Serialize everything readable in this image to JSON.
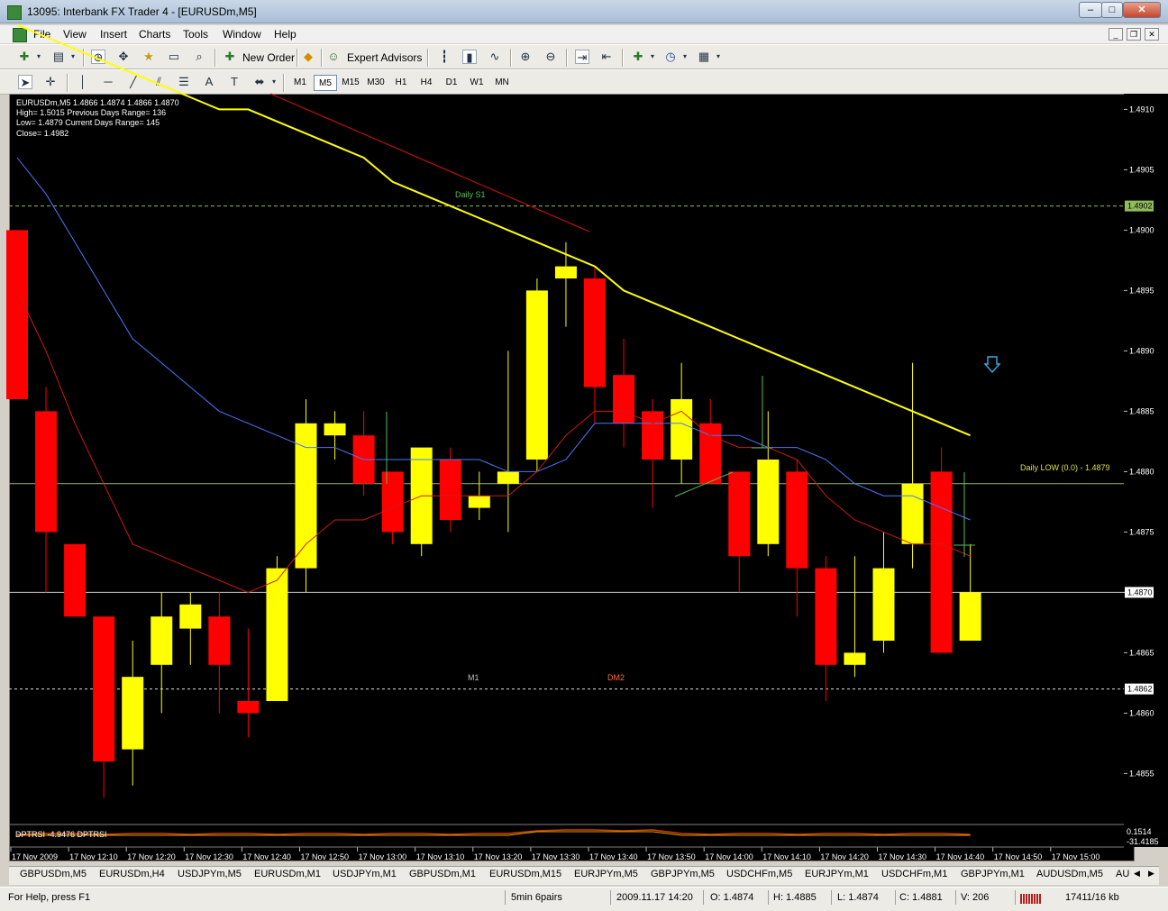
{
  "window": {
    "title": "13095: Interbank FX Trader 4 - [EURUSDm,M5]",
    "min": "–",
    "max": "□",
    "close": "✕"
  },
  "menu": [
    "File",
    "View",
    "Insert",
    "Charts",
    "Tools",
    "Window",
    "Help"
  ],
  "toolbar": {
    "new_order": "New Order",
    "expert_advisors": "Expert Advisors"
  },
  "timeframes": [
    "M1",
    "M5",
    "M15",
    "M30",
    "H1",
    "H4",
    "D1",
    "W1",
    "MN"
  ],
  "active_timeframe": "M5",
  "chart_info": {
    "line1": "EURUSDm,M5  1.4866 1.4874 1.4866 1.4870",
    "line2": "High= 1.5015    Previous Days Range= 136",
    "line3": "Low= 1.4879     Current Days Range= 145",
    "line4": "Close= 1.4982"
  },
  "labels": {
    "daily_s1": "Daily S1",
    "daily_low": "Daily LOW (0.0) - 1.4879",
    "m1": "M1",
    "dm2": "DM2"
  },
  "indicator": {
    "label": "DPTRSI -4.9476  DPTRSI",
    "scale_top": "0.1514",
    "scale_bottom": "-31.4185"
  },
  "price_axis": {
    "ticks": [
      "1.4910",
      "1.4905",
      "1.4900",
      "1.4895",
      "1.4890",
      "1.4885",
      "1.4880",
      "1.4875",
      "1.4870",
      "1.4865",
      "1.4860",
      "1.4855"
    ],
    "marker_upper": "1.4902",
    "marker_current": "1.4870",
    "marker_lower": "1.4862"
  },
  "time_axis": [
    "17 Nov 2009",
    "17 Nov 12:10",
    "17 Nov 12:20",
    "17 Nov 12:30",
    "17 Nov 12:40",
    "17 Nov 12:50",
    "17 Nov 13:00",
    "17 Nov 13:10",
    "17 Nov 13:20",
    "17 Nov 13:30",
    "17 Nov 13:40",
    "17 Nov 13:50",
    "17 Nov 14:00",
    "17 Nov 14:10",
    "17 Nov 14:20",
    "17 Nov 14:30",
    "17 Nov 14:40",
    "17 Nov 14:50",
    "17 Nov 15:00"
  ],
  "tabs": [
    "GBPUSDm,M5",
    "EURUSDm,H4",
    "USDJPYm,M5",
    "EURUSDm,M1",
    "USDJPYm,M1",
    "GBPUSDm,M1",
    "EURUSDm,M15",
    "EURJPYm,M5",
    "GBPJPYm,M5",
    "USDCHFm,M5",
    "EURJPYm,M1",
    "USDCHFm,M1",
    "GBPJPYm,M1",
    "AUDUSDm,M5",
    "AU"
  ],
  "status": {
    "help": "For Help, press F1",
    "profile": "5min 6pairs",
    "datetime": "2009.11.17 14:20",
    "open": "O: 1.4874",
    "high": "H: 1.4885",
    "low": "L: 1.4874",
    "close": "C: 1.4881",
    "volume": "V: 206",
    "traffic": "17411/16 kb"
  },
  "colors": {
    "bull": "#ffff00",
    "bear": "#ff0000",
    "ma_slow": "#ffff00",
    "ma_mid": "#4a78ff",
    "ma_fast": "#d01818",
    "level": "#8fbc5c"
  },
  "chart_data": {
    "type": "candlestick",
    "interval": "M5",
    "ylim": [
      1.4851,
      1.4911
    ],
    "candles": [
      {
        "o": 1.49,
        "h": 1.49,
        "l": 1.4886,
        "c": 1.4886
      },
      {
        "o": 1.4885,
        "h": 1.4887,
        "l": 1.487,
        "c": 1.4875
      },
      {
        "o": 1.4874,
        "h": 1.4874,
        "l": 1.4868,
        "c": 1.4868
      },
      {
        "o": 1.4868,
        "h": 1.4868,
        "l": 1.4853,
        "c": 1.4856
      },
      {
        "o": 1.4857,
        "h": 1.4866,
        "l": 1.4854,
        "c": 1.4863
      },
      {
        "o": 1.4864,
        "h": 1.487,
        "l": 1.486,
        "c": 1.4868
      },
      {
        "o": 1.4867,
        "h": 1.487,
        "l": 1.4864,
        "c": 1.4869
      },
      {
        "o": 1.4868,
        "h": 1.487,
        "l": 1.486,
        "c": 1.4864
      },
      {
        "o": 1.4861,
        "h": 1.4867,
        "l": 1.4858,
        "c": 1.486
      },
      {
        "o": 1.4861,
        "h": 1.4873,
        "l": 1.4861,
        "c": 1.4872
      },
      {
        "o": 1.4872,
        "h": 1.4886,
        "l": 1.487,
        "c": 1.4884
      },
      {
        "o": 1.4883,
        "h": 1.4885,
        "l": 1.4881,
        "c": 1.4884
      },
      {
        "o": 1.4883,
        "h": 1.4885,
        "l": 1.4878,
        "c": 1.4879
      },
      {
        "o": 1.488,
        "h": 1.488,
        "l": 1.4874,
        "c": 1.4875
      },
      {
        "o": 1.4874,
        "h": 1.4881,
        "l": 1.4873,
        "c": 1.4882
      },
      {
        "o": 1.4881,
        "h": 1.4882,
        "l": 1.4875,
        "c": 1.4876
      },
      {
        "o": 1.4877,
        "h": 1.488,
        "l": 1.4876,
        "c": 1.4878
      },
      {
        "o": 1.4879,
        "h": 1.489,
        "l": 1.4875,
        "c": 1.488
      },
      {
        "o": 1.4881,
        "h": 1.4896,
        "l": 1.488,
        "c": 1.4895
      },
      {
        "o": 1.4896,
        "h": 1.4899,
        "l": 1.4892,
        "c": 1.4897
      },
      {
        "o": 1.4896,
        "h": 1.4897,
        "l": 1.4884,
        "c": 1.4887
      },
      {
        "o": 1.4888,
        "h": 1.4891,
        "l": 1.4882,
        "c": 1.4884
      },
      {
        "o": 1.4885,
        "h": 1.4886,
        "l": 1.4877,
        "c": 1.4881
      },
      {
        "o": 1.4881,
        "h": 1.4889,
        "l": 1.4879,
        "c": 1.4886
      },
      {
        "o": 1.4884,
        "h": 1.4886,
        "l": 1.4879,
        "c": 1.4879
      },
      {
        "o": 1.488,
        "h": 1.488,
        "l": 1.487,
        "c": 1.4873
      },
      {
        "o": 1.4874,
        "h": 1.4885,
        "l": 1.4873,
        "c": 1.4881
      },
      {
        "o": 1.488,
        "h": 1.4881,
        "l": 1.4868,
        "c": 1.4872
      },
      {
        "o": 1.4872,
        "h": 1.4873,
        "l": 1.4861,
        "c": 1.4864
      },
      {
        "o": 1.4864,
        "h": 1.4873,
        "l": 1.4863,
        "c": 1.4865
      },
      {
        "o": 1.4866,
        "h": 1.4875,
        "l": 1.4865,
        "c": 1.4872
      },
      {
        "o": 1.4874,
        "h": 1.4889,
        "l": 1.4872,
        "c": 1.4879
      },
      {
        "o": 1.488,
        "h": 1.4882,
        "l": 1.4865,
        "c": 1.4865
      },
      {
        "o": 1.4866,
        "h": 1.4874,
        "l": 1.4866,
        "c": 1.487
      }
    ],
    "lines": [
      {
        "name": "",
        "values": [
          1.4917,
          1.4916,
          1.4915,
          1.4914,
          1.4913,
          1.4912,
          1.4911,
          1.491,
          1.491,
          1.4909,
          1.4908,
          1.4907,
          1.4906,
          1.4904,
          1.4903,
          1.4902,
          1.4901,
          1.49,
          1.4899,
          1.4898,
          1.4897,
          1.4895,
          1.4894,
          1.4893,
          1.4892,
          1.4891,
          1.489,
          1.4889,
          1.4888,
          1.4887,
          1.4886,
          1.4885,
          1.4884,
          1.4883
        ]
      },
      {
        "name": "",
        "values": [
          1.4906,
          1.4903,
          1.4899,
          1.4895,
          1.4891,
          1.4889,
          1.4887,
          1.4885,
          1.4884,
          1.4883,
          1.4882,
          1.4882,
          1.4881,
          1.4881,
          1.4881,
          1.4881,
          1.4881,
          1.488,
          1.488,
          1.4881,
          1.4884,
          1.4884,
          1.4884,
          1.4884,
          1.4883,
          1.4883,
          1.4882,
          1.4882,
          1.4881,
          1.4879,
          1.4878,
          1.4878,
          1.4877,
          1.4876
        ]
      },
      {
        "name": "",
        "values": [
          1.4895,
          1.489,
          1.4884,
          1.4879,
          1.4874,
          1.4873,
          1.4872,
          1.4871,
          1.487,
          1.4871,
          1.4874,
          1.4876,
          1.4876,
          1.4877,
          1.4878,
          1.4878,
          1.4878,
          1.4878,
          1.488,
          1.4883,
          1.4885,
          1.4885,
          1.4884,
          1.4885,
          1.4883,
          1.4882,
          1.4882,
          1.4881,
          1.4878,
          1.4876,
          1.4875,
          1.4874,
          1.4874,
          1.4873
        ]
      }
    ],
    "levels": [
      1.4902,
      1.4879,
      1.487,
      1.4862
    ]
  }
}
